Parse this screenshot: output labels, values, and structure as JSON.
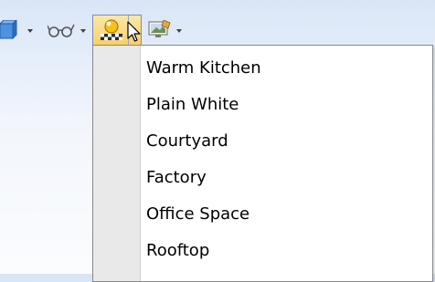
{
  "toolbar": {
    "icons": [
      "view-cube-icon",
      "glasses-icon",
      "scene-lighting-icon",
      "display-settings-icon"
    ]
  },
  "scene_menu": {
    "items": [
      {
        "label": "Warm Kitchen"
      },
      {
        "label": "Plain White"
      },
      {
        "label": "Courtyard"
      },
      {
        "label": "Factory"
      },
      {
        "label": "Office Space"
      },
      {
        "label": "Rooftop"
      }
    ]
  },
  "colors": {
    "background": "#e4edf9",
    "menu_background": "#ffffff",
    "menu_gutter": "#e9e9e9",
    "active_button": "#f7cf68"
  }
}
